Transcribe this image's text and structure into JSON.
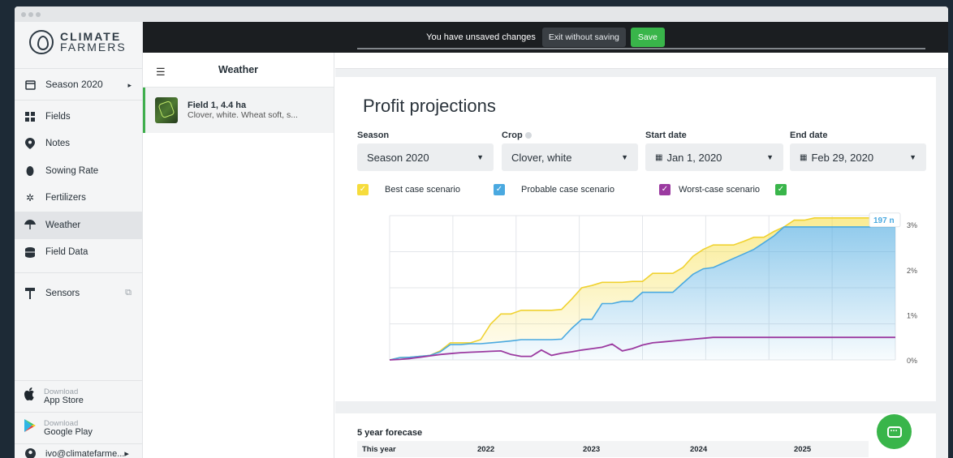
{
  "brand": {
    "line1": "CLIMATE",
    "line2": "FARMERS"
  },
  "sidebar": {
    "season": "Season 2020",
    "items": [
      {
        "label": "Fields",
        "icon": "grid-icon"
      },
      {
        "label": "Notes",
        "icon": "map-pin-icon"
      },
      {
        "label": "Sowing Rate",
        "icon": "seed-icon"
      },
      {
        "label": "Fertilizers",
        "icon": "fertilizer-icon"
      },
      {
        "label": "Weather",
        "icon": "umbrella-icon",
        "active": true
      },
      {
        "label": "Field Data",
        "icon": "database-icon"
      },
      {
        "label": "Sensors",
        "icon": "sensor-icon"
      }
    ],
    "app_store": {
      "small": "Download",
      "big": "App Store"
    },
    "google_play": {
      "small": "Download",
      "big": "Google Play"
    },
    "user_email": "ivo@climatefarme...▸"
  },
  "topbar": {
    "message": "You have unsaved changes",
    "exit_label": "Exit without saving",
    "save_label": "Save"
  },
  "field_panel": {
    "title": "Weather",
    "field_name": "Field 1, 4.4 ha",
    "field_desc": "Clover, white. Wheat soft, s..."
  },
  "profit": {
    "title": "Profit projections",
    "season_label": "Season",
    "season_value": "Season 2020",
    "crop_label": "Crop",
    "crop_value": "Clover, white",
    "start_label": "Start date",
    "start_value": "Jan 1, 2020",
    "end_label": "End date",
    "end_value": "Feb 29, 2020",
    "legend": [
      {
        "label": "Best case scenario",
        "color": "#f6dc3c"
      },
      {
        "label": "Probable case scenario",
        "color": "#4aa9e0"
      },
      {
        "label": "Worst-case scenario",
        "color": "#9b3aa0"
      },
      {
        "label": "",
        "color": "#39b54a"
      }
    ],
    "tooltip": "197 n"
  },
  "chart_data": {
    "type": "area",
    "x": [
      0,
      1,
      2,
      3,
      4,
      5,
      6,
      7,
      8,
      9,
      10,
      11,
      12,
      13,
      14,
      15,
      16,
      17,
      18,
      19,
      20,
      21,
      22,
      23,
      24,
      25,
      26,
      27,
      28,
      29,
      30,
      31,
      32,
      33,
      34,
      35,
      36,
      37,
      38,
      39,
      40,
      41,
      42,
      43,
      44,
      45,
      46,
      47,
      48,
      49,
      50
    ],
    "yticks": [
      "0%",
      "1%",
      "2%",
      "3%"
    ],
    "ylim": [
      0,
      3.2
    ],
    "series": [
      {
        "name": "Best case scenario",
        "color": "#f6dc3c",
        "values": [
          0.0,
          0.05,
          0.06,
          0.08,
          0.1,
          0.2,
          0.38,
          0.38,
          0.38,
          0.45,
          0.8,
          1.02,
          1.02,
          1.1,
          1.1,
          1.1,
          1.1,
          1.12,
          1.35,
          1.6,
          1.65,
          1.72,
          1.72,
          1.72,
          1.74,
          1.74,
          1.92,
          1.92,
          1.92,
          2.05,
          2.3,
          2.45,
          2.55,
          2.55,
          2.55,
          2.63,
          2.72,
          2.72,
          2.85,
          2.95,
          3.1,
          3.1,
          3.15,
          3.15,
          3.15,
          3.15,
          3.15,
          3.15,
          3.15,
          3.15,
          3.15
        ]
      },
      {
        "name": "Probable case scenario",
        "color": "#4aa9e0",
        "values": [
          0.0,
          0.05,
          0.06,
          0.08,
          0.1,
          0.18,
          0.34,
          0.34,
          0.36,
          0.36,
          0.38,
          0.4,
          0.42,
          0.45,
          0.45,
          0.45,
          0.45,
          0.46,
          0.7,
          0.9,
          0.9,
          1.25,
          1.25,
          1.3,
          1.3,
          1.5,
          1.5,
          1.5,
          1.5,
          1.7,
          1.9,
          2.02,
          2.05,
          2.15,
          2.25,
          2.35,
          2.45,
          2.6,
          2.75,
          2.95,
          2.95,
          2.95,
          2.95,
          2.95,
          2.95,
          2.95,
          2.95,
          2.95,
          2.95,
          2.95,
          2.95
        ]
      },
      {
        "name": "Worst-case scenario",
        "color": "#9b3aa0",
        "values": [
          0.0,
          0.01,
          0.03,
          0.06,
          0.09,
          0.12,
          0.14,
          0.16,
          0.17,
          0.18,
          0.19,
          0.2,
          0.12,
          0.08,
          0.08,
          0.22,
          0.1,
          0.15,
          0.18,
          0.22,
          0.25,
          0.28,
          0.35,
          0.2,
          0.25,
          0.33,
          0.38,
          0.4,
          0.42,
          0.44,
          0.46,
          0.48,
          0.5,
          0.5,
          0.5,
          0.5,
          0.5,
          0.5,
          0.5,
          0.5,
          0.5,
          0.5,
          0.5,
          0.5,
          0.5,
          0.5,
          0.5,
          0.5,
          0.5,
          0.5,
          0.5
        ]
      }
    ]
  },
  "forecast": {
    "title": "5 year forecase",
    "headers": [
      "This year",
      "2022",
      "2023",
      "2024",
      "2025"
    ]
  }
}
